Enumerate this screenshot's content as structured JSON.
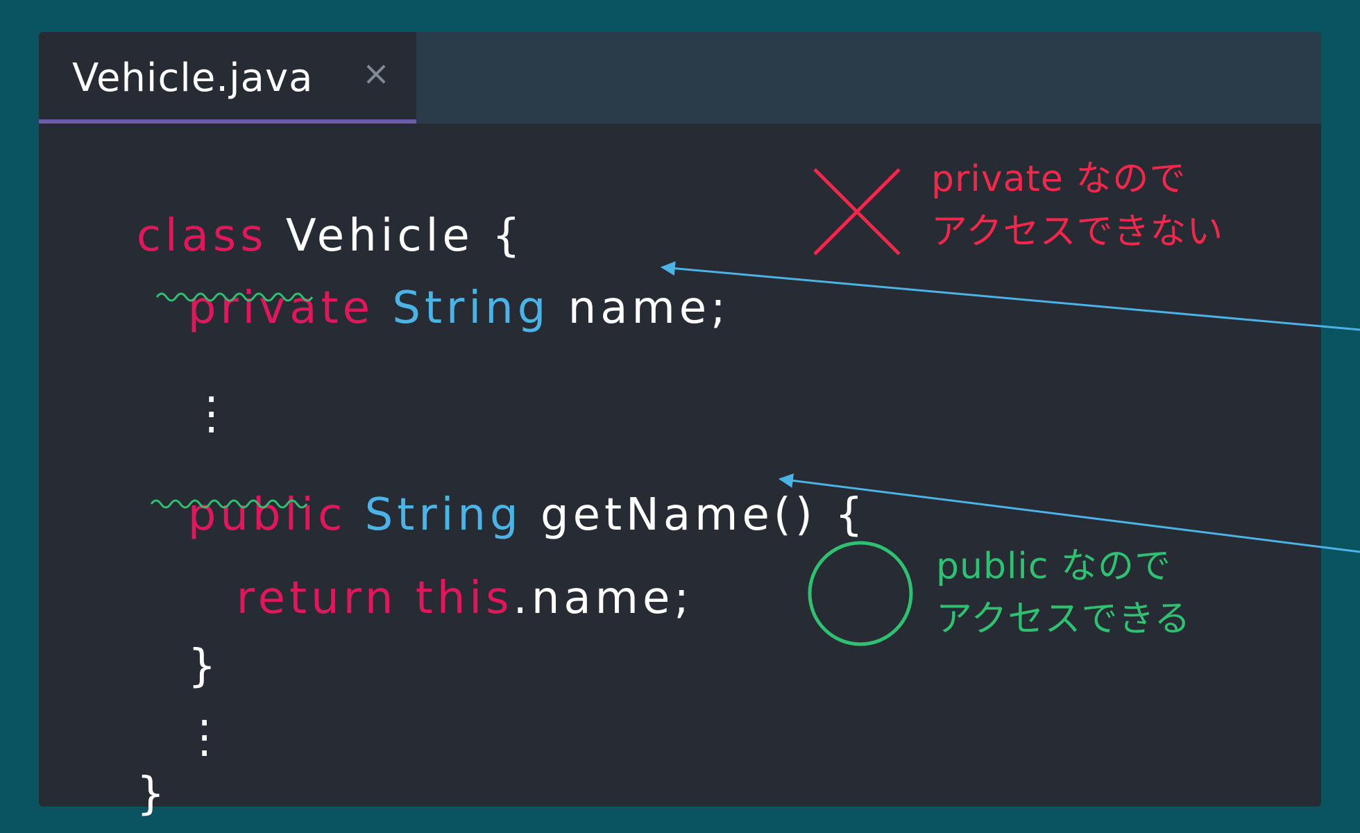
{
  "tab": {
    "title": "Vehicle.java",
    "close_label": "×"
  },
  "code": {
    "line1": {
      "keyword": "class",
      "rest": " Vehicle {"
    },
    "line2": {
      "keyword": "private",
      "type": "String",
      "rest": " name;"
    },
    "line3": {
      "text": "⋮"
    },
    "line4": {
      "keyword": "public",
      "type": "String",
      "rest": " getName() {"
    },
    "line5": {
      "keyword1": "return",
      "keyword2": "this",
      "rest": ".name;"
    },
    "line6": {
      "text": "}"
    },
    "line7": {
      "text": "⋮"
    },
    "line8": {
      "text": "}"
    }
  },
  "annotations": {
    "private_note": {
      "line1": "private なので",
      "line2": "アクセスできない"
    },
    "public_note": {
      "line1": "public なので",
      "line2": "アクセスできる"
    }
  },
  "colors": {
    "background": "#0a5462",
    "editor": "#272b33",
    "tabbar": "#2a3b4a",
    "tab_underline": "#6b5ba8",
    "keyword": "#e0175a",
    "type": "#4cb3e6",
    "arrow": "#4cb3e6",
    "deny": "#f1274c",
    "allow": "#2fc072"
  },
  "icons": {
    "deny_mark": "cross-icon",
    "allow_mark": "circle-icon"
  }
}
